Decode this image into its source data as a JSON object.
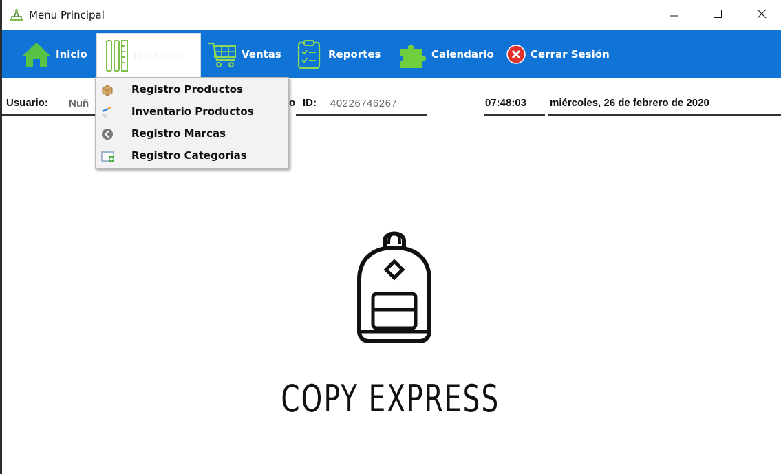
{
  "window": {
    "title": "Menu Principal"
  },
  "menu": {
    "items": [
      {
        "label": "Inicio",
        "icon": "home-icon"
      },
      {
        "label": "Productos",
        "icon": "tools-icon"
      },
      {
        "label": "Ventas",
        "icon": "cart-icon"
      },
      {
        "label": "Reportes",
        "icon": "clipboard-icon"
      },
      {
        "label": "Calendario",
        "icon": "puzzle-icon"
      },
      {
        "label": "Cerrar Sesión",
        "icon": "close-circle-icon"
      }
    ]
  },
  "dropdown": {
    "items": [
      {
        "label": "Registro Productos",
        "icon": "box-icon"
      },
      {
        "label": "Inventario Productos",
        "icon": "pencil-icon"
      },
      {
        "label": "Registro Marcas",
        "icon": "back-circle-icon"
      },
      {
        "label": "Registro Categorias",
        "icon": "add-window-icon"
      }
    ]
  },
  "info": {
    "user_label": "Usuario:",
    "user_value": "Nuñ",
    "id_label": "ID:",
    "id_value": "40226746267",
    "partial_text": "o",
    "time": "07:48:03",
    "date": "miércoles, 26 de febrero de 2020"
  },
  "brand": {
    "name": "COPY EXPRESS",
    "logo_icon": "backpack-icon"
  },
  "colors": {
    "menu_bg": "#0f74d6",
    "accent_green": "#4caf50",
    "close_red": "#e0312b"
  }
}
